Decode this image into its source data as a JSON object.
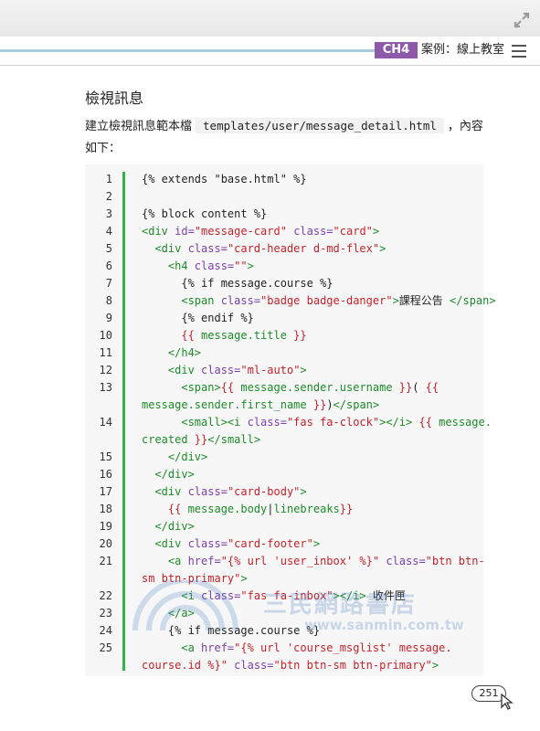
{
  "header": {
    "chapter_badge": "CH4",
    "chapter_title": "案例：線上教室",
    "expand_icon": "expand-icon",
    "menu_icon": "hamburger-menu-icon"
  },
  "section": {
    "heading": "檢視訊息",
    "intro_before": "建立檢視訊息範本檔",
    "intro_code": "templates/user/message_detail.html",
    "intro_after": "，內容如下："
  },
  "code": {
    "lines": [
      {
        "n": "1",
        "rows": [
          [
            [
              "t",
              "{% extends \"base.html\" %}"
            ]
          ]
        ]
      },
      {
        "n": "2",
        "rows": [
          [
            [
              "t",
              ""
            ]
          ]
        ]
      },
      {
        "n": "3",
        "rows": [
          [
            [
              "t",
              "{% block content %}"
            ]
          ]
        ]
      },
      {
        "n": "4",
        "rows": [
          [
            [
              "tag",
              "<div "
            ],
            [
              "attr",
              "id="
            ],
            [
              "str",
              "\"message-card\""
            ],
            [
              "attr",
              " class="
            ],
            [
              "str",
              "\"card\""
            ],
            [
              "tag",
              ">"
            ]
          ]
        ]
      },
      {
        "n": "5",
        "rows": [
          [
            [
              "tag",
              "  <div "
            ],
            [
              "attr",
              "class="
            ],
            [
              "str",
              "\"card-header d-md-flex\""
            ],
            [
              "tag",
              ">"
            ]
          ]
        ]
      },
      {
        "n": "6",
        "rows": [
          [
            [
              "tag",
              "    <h4 "
            ],
            [
              "attr",
              "class="
            ],
            [
              "str",
              "\"\""
            ],
            [
              "tag",
              ">"
            ]
          ]
        ]
      },
      {
        "n": "7",
        "rows": [
          [
            [
              "t",
              "      {% if message.course %}"
            ]
          ]
        ]
      },
      {
        "n": "8",
        "rows": [
          [
            [
              "tag",
              "      <span "
            ],
            [
              "attr",
              "class="
            ],
            [
              "str",
              "\"badge badge-danger\""
            ],
            [
              "tag",
              ">"
            ],
            [
              "t",
              "課程公告 "
            ],
            [
              "tag",
              "</span>"
            ]
          ]
        ]
      },
      {
        "n": "9",
        "rows": [
          [
            [
              "t",
              "      {% endif %}"
            ]
          ]
        ]
      },
      {
        "n": "10",
        "rows": [
          [
            [
              "str",
              "      {{ "
            ],
            [
              "tag",
              "message.title"
            ],
            [
              "str",
              " }}"
            ]
          ]
        ]
      },
      {
        "n": "11",
        "rows": [
          [
            [
              "tag",
              "    </h4>"
            ]
          ]
        ]
      },
      {
        "n": "12",
        "rows": [
          [
            [
              "tag",
              "    <div "
            ],
            [
              "attr",
              "class="
            ],
            [
              "str",
              "\"ml-auto\""
            ],
            [
              "tag",
              ">"
            ]
          ]
        ]
      },
      {
        "n": "13",
        "rows": [
          [
            [
              "tag",
              "      <span>"
            ],
            [
              "str",
              "{{ "
            ],
            [
              "tag",
              "message.sender.username"
            ],
            [
              "str",
              " }}"
            ],
            [
              "t",
              "( "
            ],
            [
              "str",
              "{{"
            ]
          ],
          [
            [
              "tag",
              "message.sender.first_name"
            ],
            [
              "str",
              " }}"
            ],
            [
              "t",
              ")"
            ],
            [
              "tag",
              "</span>"
            ]
          ]
        ]
      },
      {
        "n": "14",
        "rows": [
          [
            [
              "tag",
              "      <small><i "
            ],
            [
              "attr",
              "class="
            ],
            [
              "str",
              "\"fas fa-clock\""
            ],
            [
              "tag",
              "></i> "
            ],
            [
              "str",
              "{{ "
            ],
            [
              "tag",
              "message."
            ]
          ],
          [
            [
              "tag",
              "created"
            ],
            [
              "str",
              " }}"
            ],
            [
              "tag",
              "</small>"
            ]
          ]
        ]
      },
      {
        "n": "15",
        "rows": [
          [
            [
              "tag",
              "    </div>"
            ]
          ]
        ]
      },
      {
        "n": "16",
        "rows": [
          [
            [
              "tag",
              "  </div>"
            ]
          ]
        ]
      },
      {
        "n": "17",
        "rows": [
          [
            [
              "tag",
              "  <div "
            ],
            [
              "attr",
              "class="
            ],
            [
              "str",
              "\"card-body\""
            ],
            [
              "tag",
              ">"
            ]
          ]
        ]
      },
      {
        "n": "18",
        "rows": [
          [
            [
              "str",
              "    {{ "
            ],
            [
              "tag",
              "message.body"
            ],
            [
              "t",
              "|"
            ],
            [
              "tag",
              "linebreaks"
            ],
            [
              "str",
              "}}"
            ]
          ]
        ]
      },
      {
        "n": "19",
        "rows": [
          [
            [
              "tag",
              "  </div>"
            ]
          ]
        ]
      },
      {
        "n": "20",
        "rows": [
          [
            [
              "tag",
              "  <div "
            ],
            [
              "attr",
              "class="
            ],
            [
              "str",
              "\"card-footer\""
            ],
            [
              "tag",
              ">"
            ]
          ]
        ]
      },
      {
        "n": "21",
        "rows": [
          [
            [
              "tag",
              "    <a "
            ],
            [
              "attr",
              "href="
            ],
            [
              "str",
              "\"{% url 'user_inbox' %}\""
            ],
            [
              "attr",
              " class="
            ],
            [
              "str",
              "\"btn btn-"
            ]
          ],
          [
            [
              "str",
              "sm btn-primary\""
            ],
            [
              "tag",
              ">"
            ]
          ]
        ]
      },
      {
        "n": "22",
        "rows": [
          [
            [
              "tag",
              "      <i "
            ],
            [
              "attr",
              "class="
            ],
            [
              "str",
              "\"fas fa-inbox\""
            ],
            [
              "tag",
              "></i>"
            ],
            [
              "t",
              " 收件匣"
            ]
          ]
        ]
      },
      {
        "n": "23",
        "rows": [
          [
            [
              "tag",
              "    </a>"
            ]
          ]
        ]
      },
      {
        "n": "24",
        "rows": [
          [
            [
              "t",
              "    {% if message.course %}"
            ]
          ]
        ]
      },
      {
        "n": "25",
        "rows": [
          [
            [
              "tag",
              "      <a "
            ],
            [
              "attr",
              "href="
            ],
            [
              "str",
              "\"{% url 'course_msglist' message."
            ]
          ],
          [
            [
              "str",
              "course.id %}\""
            ],
            [
              "attr",
              " class="
            ],
            [
              "str",
              "\"btn btn-sm btn-primary\""
            ],
            [
              "tag",
              ">"
            ]
          ]
        ]
      }
    ]
  },
  "watermark": {
    "name": "三民網路書店",
    "url": "www.sanmin.com.tw"
  },
  "footer": {
    "page_number": "251",
    "cursor_icon": "hand-cursor-icon"
  },
  "colors": {
    "chapter_badge": "#8c5aa8",
    "code_tag": "#1e8a2a",
    "code_attr": "#7b3fa8",
    "code_string": "#c0242c",
    "gutter_bar": "#36b24a"
  }
}
